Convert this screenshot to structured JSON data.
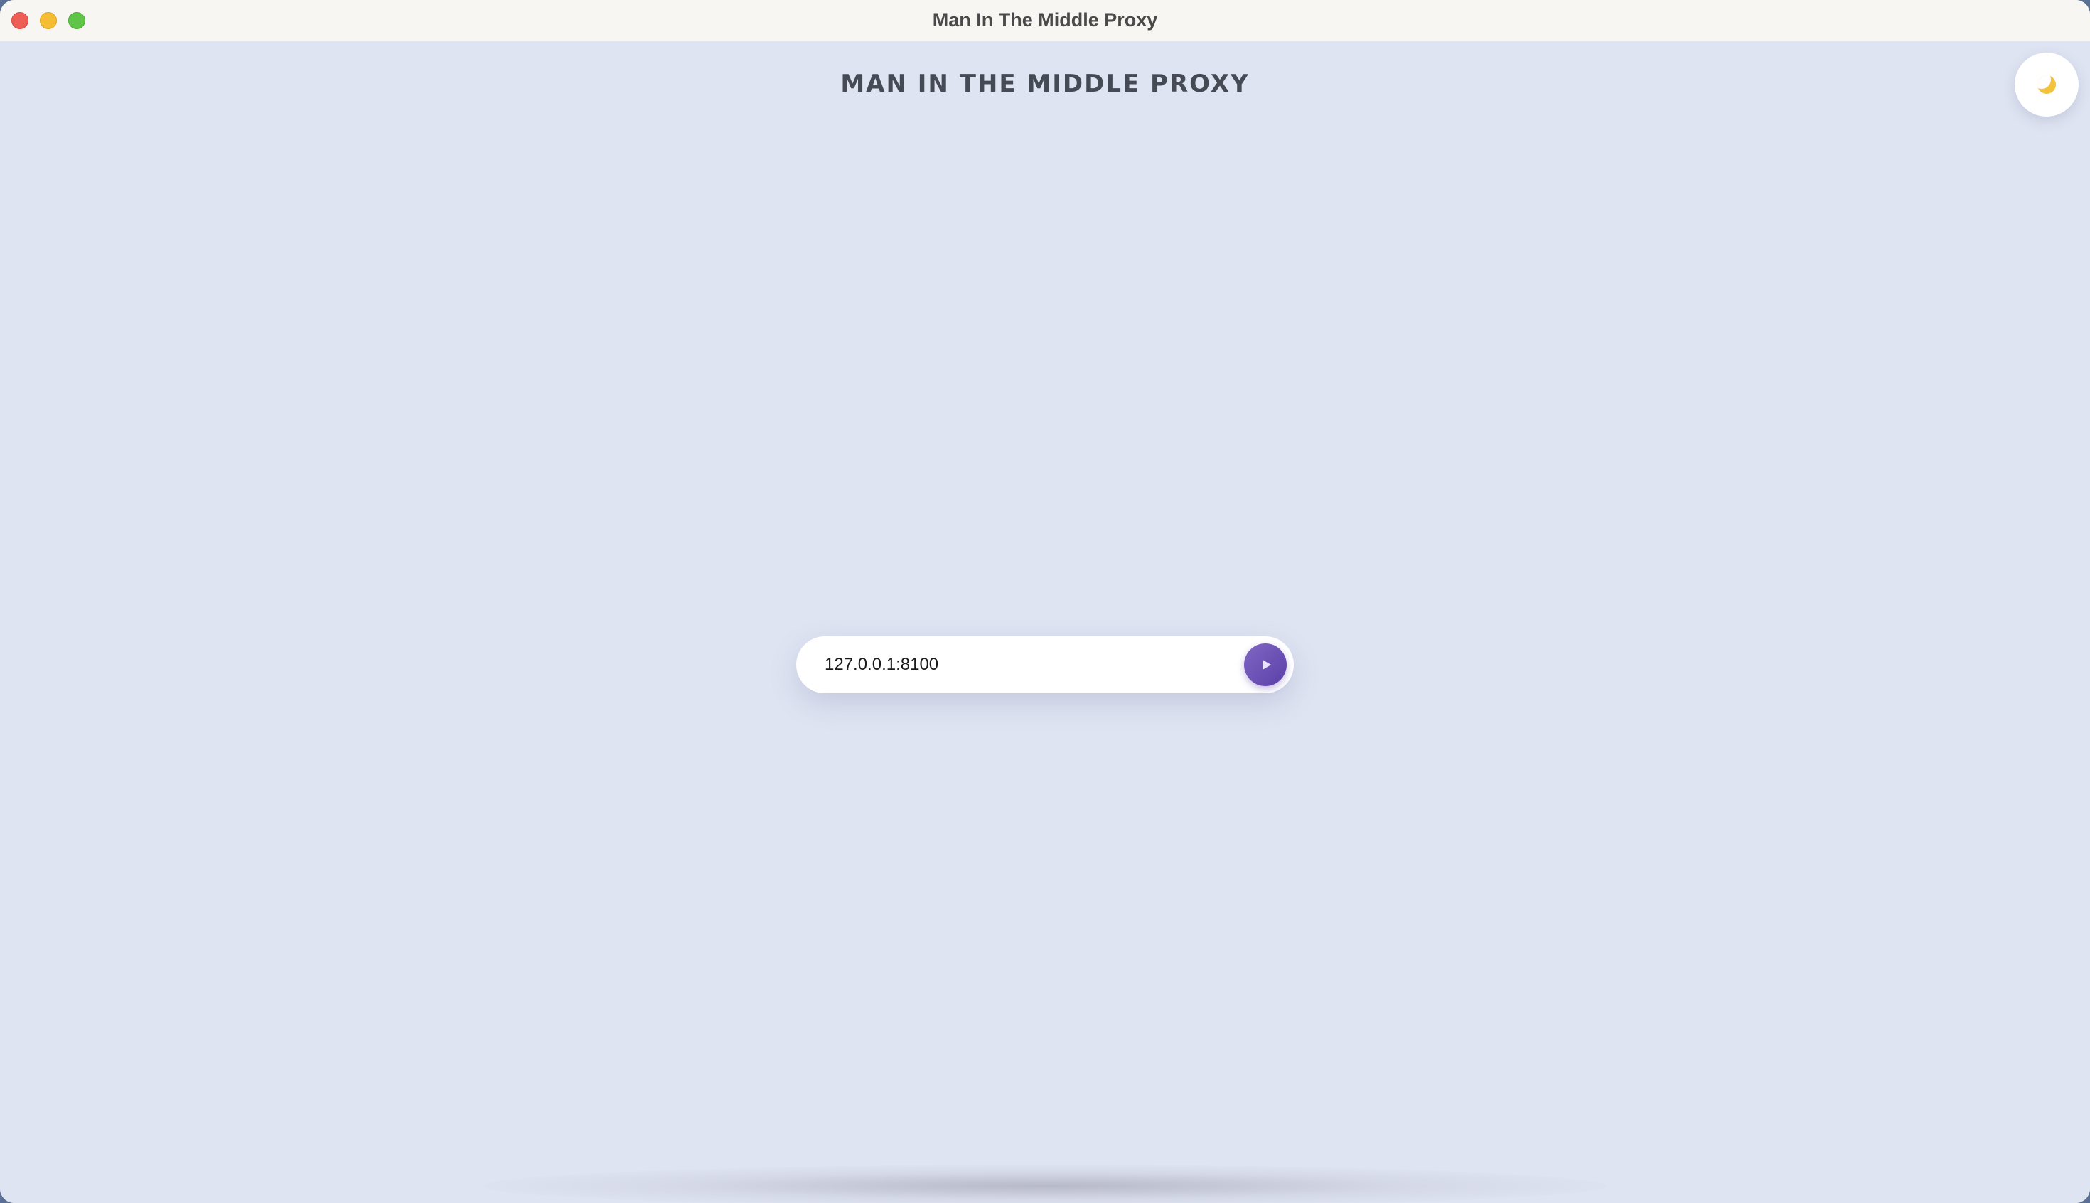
{
  "window": {
    "title": "Man In The Middle Proxy"
  },
  "header": {
    "title": "MAN IN THE MIDDLE PROXY"
  },
  "theme_toggle": {
    "icon": "moon-icon",
    "icon_color": "#f2c23d"
  },
  "proxy": {
    "address_value": "127.0.0.1:8100",
    "start_icon": "play-icon",
    "button_color": "#6a4fb8"
  },
  "colors": {
    "background": "#dfe4f2",
    "titlebar": "#f8f6f2",
    "title_text": "#454a55"
  }
}
